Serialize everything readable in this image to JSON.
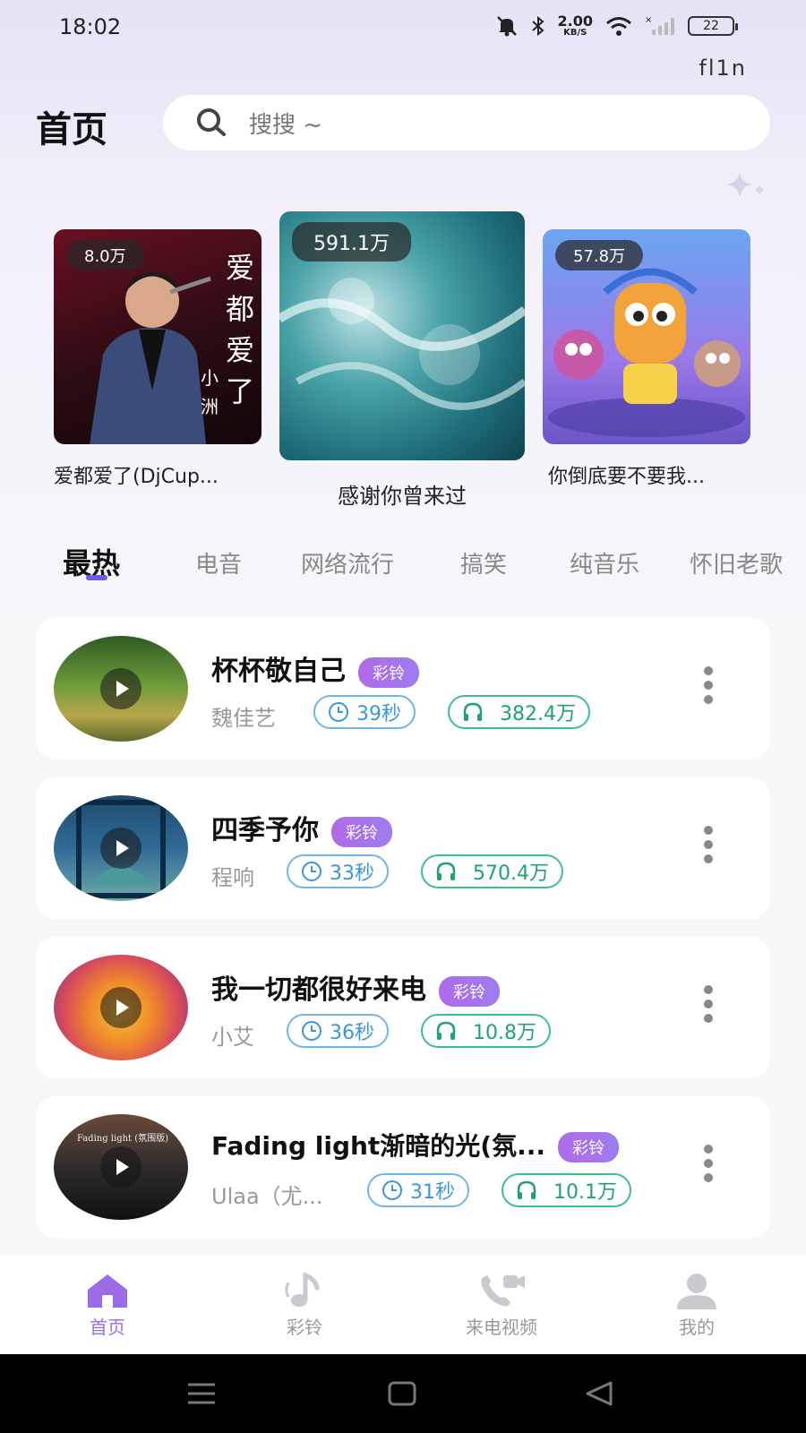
{
  "status_bar": {
    "time": "18:02",
    "net_speed_value": "2.00",
    "net_speed_unit": "KB/S",
    "battery": "22"
  },
  "corner_text": "fl1n",
  "header": {
    "title": "首页",
    "search_placeholder": "搜搜 ~"
  },
  "banners": [
    {
      "plays": "8.0万",
      "title": "爱都爱了(DjCup...",
      "cover_text": "爱都爱了",
      "cover_subtext": "小洲"
    },
    {
      "plays": "591.1万",
      "title": "感谢你曾来过"
    },
    {
      "plays": "57.8万",
      "title": "你倒底要不要我..."
    }
  ],
  "tabs": [
    "最热",
    "电音",
    "网络流行",
    "搞笑",
    "纯音乐",
    "怀旧老歌"
  ],
  "songs": [
    {
      "title": "杯杯敬自己",
      "tag": "彩铃",
      "artist": "魏佳艺",
      "duration": "39秒",
      "plays": "382.4万"
    },
    {
      "title": "四季予你",
      "tag": "彩铃",
      "artist": "程响",
      "duration": "33秒",
      "plays": "570.4万"
    },
    {
      "title": "我一切都很好来电",
      "tag": "彩铃",
      "artist": "小艾",
      "duration": "36秒",
      "plays": "10.8万"
    },
    {
      "title": "Fading light渐暗的光(氛...",
      "tag": "彩铃",
      "artist": "Ulaa（尤...",
      "duration": "31秒",
      "plays": "10.1万",
      "cover_text": "Fading light (氛围版)"
    }
  ],
  "bottom_nav": [
    {
      "label": "首页",
      "icon": "home-icon",
      "active": true
    },
    {
      "label": "彩铃",
      "icon": "music-note-icon",
      "active": false
    },
    {
      "label": "来电视频",
      "icon": "video-call-icon",
      "active": false
    },
    {
      "label": "我的",
      "icon": "user-icon",
      "active": false
    }
  ],
  "colors": {
    "accent": "#9a6ce6",
    "tag_gradient_start": "#b06be8",
    "duration_blue": "#3a97d6",
    "plays_green": "#1ea46c"
  }
}
